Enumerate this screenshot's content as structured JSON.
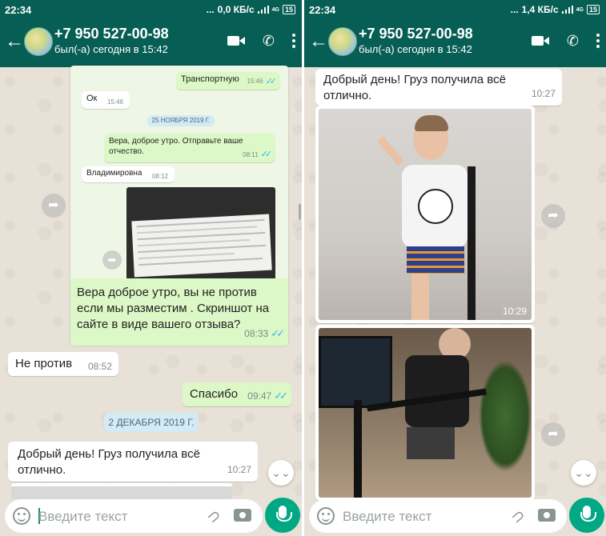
{
  "status_left": {
    "time": "22:34",
    "speed": "0,0 КБ/с",
    "network": "4G",
    "battery": "15"
  },
  "status_right": {
    "time": "22:34",
    "speed": "1,4 КБ/с",
    "network": "4G",
    "battery": "15"
  },
  "header": {
    "name": "+7 950 527-00-98",
    "subtitle": "был(-а) сегодня в 15:42"
  },
  "left": {
    "screenshot": {
      "msg1": {
        "text": "Транспортную",
        "time": "15:46"
      },
      "msg2": {
        "text": "Ок",
        "time": "15:46"
      },
      "date": "25 НОЯБРЯ 2019 Г.",
      "msg3": {
        "text": "Вера,  доброе утро. Отправьте ваше отчество.",
        "time": "08:11"
      },
      "msg4": {
        "text": "Владимировна",
        "time": "08:12"
      }
    },
    "caption": {
      "text": "Вера доброе утро, вы не против если мы разместим . Скриншот на сайте в виде вашего отзыва?",
      "time": "08:33"
    },
    "msg_ne_protiv": {
      "text": "Не против",
      "time": "08:52"
    },
    "msg_spasibo": {
      "text": "Спасибо",
      "time": "09:47"
    },
    "date2": "2 ДЕКАБРЯ 2019 Г.",
    "msg_dobryi": {
      "text": "Добрый день! Груз получила всё отлично.",
      "time": "10:27"
    }
  },
  "right": {
    "msg_dobryi": {
      "text": "Добрый день! Груз получила всё отлично.",
      "time": "10:27"
    },
    "photo1_time": "10:29"
  },
  "input": {
    "placeholder": "Введите текст"
  },
  "icons": {
    "back": "arrow-left",
    "video": "video-camera",
    "call": "phone",
    "menu": "three-dots",
    "forward": "share-arrow",
    "scroll_down": "double-chevron-down",
    "emoji": "smiley",
    "attach": "paperclip",
    "camera": "camera",
    "mic": "microphone"
  },
  "colors": {
    "header": "#075e54",
    "outgoing": "#dcf8c6",
    "incoming": "#ffffff",
    "ticks": "#34b7f1",
    "mic": "#00a884"
  }
}
